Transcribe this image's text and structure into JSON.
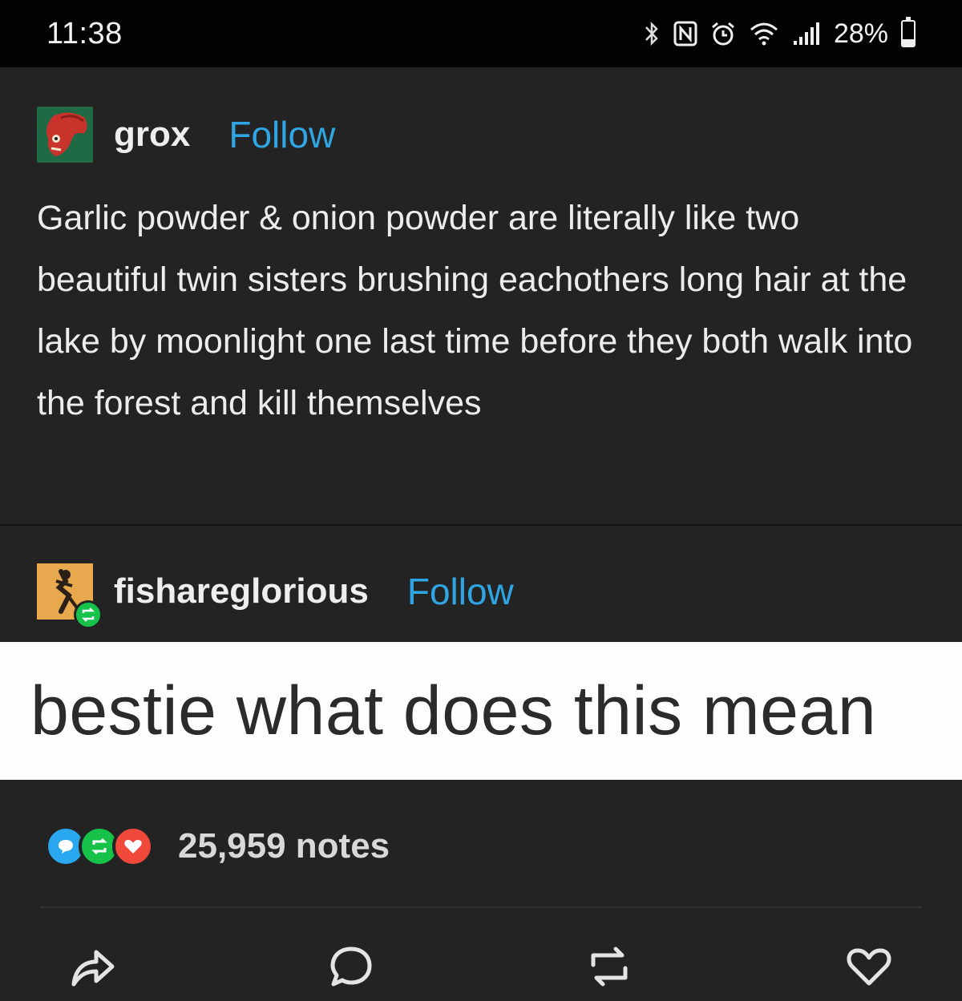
{
  "status_bar": {
    "time": "11:38",
    "battery_percent": "28%",
    "battery_level": 0.28,
    "icons": [
      "bluetooth-icon",
      "nfc-icon",
      "alarm-icon",
      "wifi-icon",
      "signal-icon",
      "battery-icon"
    ]
  },
  "post": {
    "op": {
      "username": "grox",
      "follow_label": "Follow",
      "avatar_icon": "red-creature-avatar",
      "text": "Garlic powder & onion powder are literally like two beautiful twin sisters brushing eachothers long hair at the lake by moonlight one last time before they both walk into the forest and kill themselves"
    },
    "reblog": {
      "username": "fishareglorious",
      "follow_label": "Follow",
      "avatar_icon": "figure-avatar",
      "badge_icon": "reblog-badge-icon",
      "text": "bestie what does this mean"
    },
    "notes": {
      "count_label": "25,959 notes",
      "bubbles": [
        "comment-bubble-icon",
        "reblog-bubble-icon",
        "like-bubble-icon"
      ],
      "colors": {
        "comment": "#2aa8ef",
        "reblog": "#16c24a",
        "like": "#f0483a"
      }
    },
    "actions": [
      "share-icon",
      "reply-icon",
      "reblog-icon",
      "like-icon"
    ]
  },
  "colors": {
    "background": "#232323",
    "follow": "#2fa6e3",
    "status_bar": "#020202"
  }
}
